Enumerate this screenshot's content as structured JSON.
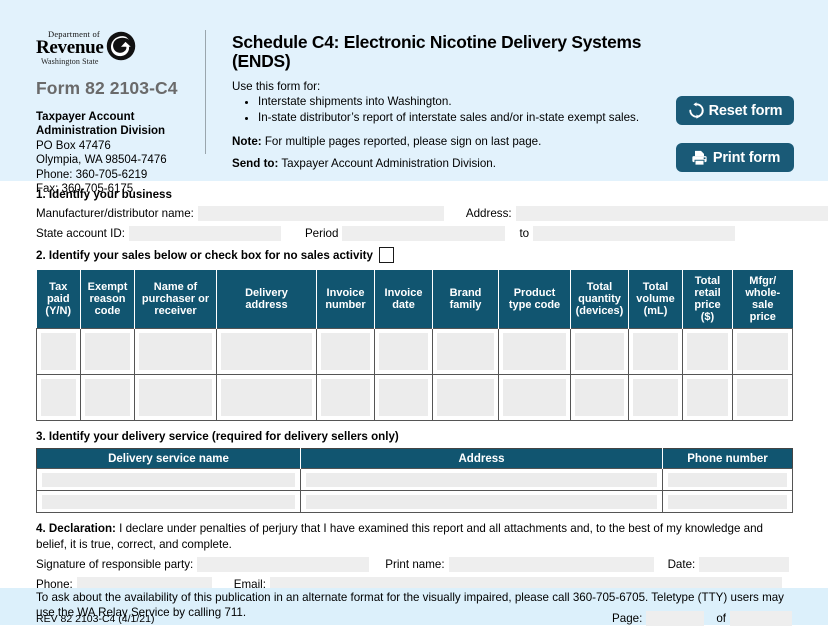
{
  "agency": {
    "dept_line": "Department of",
    "name": "Revenue",
    "state": "Washington State",
    "logo_icon": "dor-swirl-icon"
  },
  "form": {
    "number": "Form 82 2103-C4",
    "division_line1": "Taxpayer Account",
    "division_line2": "Administration Division",
    "po_box": "PO Box 47476",
    "city_state_zip": "Olympia, WA 98504-7476",
    "phone": "Phone: 360-705-6219",
    "fax": "Fax: 360-705-6175"
  },
  "header": {
    "title": "Schedule C4: Electronic Nicotine Delivery Systems (ENDS)",
    "use_for_label": "Use this form for:",
    "bullets": [
      "Interstate shipments into Washington.",
      "In-state distributor’s report of interstate sales and/or in-state exempt sales."
    ],
    "note_label": "Note:",
    "note_text": " For multiple pages reported, please sign on last page.",
    "sendto_label": "Send to:",
    "sendto_text": " Taxpayer Account Administration Division."
  },
  "buttons": {
    "reset_label": "Reset form",
    "reset_icon": "reset-circular-arrow-icon",
    "print_label": "Print form",
    "print_icon": "printer-icon",
    "color": "#1a5a77"
  },
  "section1": {
    "heading": "1. Identify your business",
    "manufacturer_label": "Manufacturer/distributor name:",
    "manufacturer_value": "",
    "address_label": "Address:",
    "address_value": "",
    "state_account_label": "State account ID:",
    "state_account_value": "",
    "period_label": "Period",
    "period_from_value": "",
    "period_to_label": "to",
    "period_to_value": ""
  },
  "section2": {
    "heading": "2. Identify your sales below or check box for no sales activity",
    "no_sales_checked": false,
    "columns": [
      "Tax paid (Y/N)",
      "Exempt reason code",
      "Name of purchaser or receiver",
      "Delivery address",
      "Invoice number",
      "Invoice date",
      "Brand family",
      "Product type code",
      "Total quantity (devices)",
      "Total volume (mL)",
      "Total retail price ($)",
      "Mfgr/ whole- sale price"
    ],
    "columns_lines": [
      [
        "Tax",
        "paid",
        "(Y/N)"
      ],
      [
        "Exempt",
        "reason",
        "code"
      ],
      [
        "Name of",
        "purchaser or",
        "receiver"
      ],
      [
        "Delivery",
        "address"
      ],
      [
        "Invoice",
        "number"
      ],
      [
        "Invoice",
        "date"
      ],
      [
        "Brand",
        "family"
      ],
      [
        "Product",
        "type code"
      ],
      [
        "Total",
        "quantity",
        "(devices)"
      ],
      [
        "Total",
        "volume",
        "(mL)"
      ],
      [
        "Total",
        "retail",
        "price",
        "($)"
      ],
      [
        "Mfgr/",
        "whole-",
        "sale",
        "price"
      ]
    ],
    "rows": [
      [
        "",
        "",
        "",
        "",
        "",
        "",
        "",
        "",
        "",
        "",
        "",
        ""
      ],
      [
        "",
        "",
        "",
        "",
        "",
        "",
        "",
        "",
        "",
        "",
        "",
        ""
      ]
    ]
  },
  "section3": {
    "heading": "3. Identify your delivery service (required for delivery sellers only)",
    "columns": [
      "Delivery service name",
      "Address",
      "Phone number"
    ],
    "rows": [
      [
        "",
        "",
        ""
      ],
      [
        "",
        "",
        ""
      ]
    ]
  },
  "section4": {
    "label": "4. Declaration:",
    "text": " I declare under penalties of perjury that I have examined this report and all attachments and, to the best of my knowledge and belief, it is true, correct, and complete.",
    "signature_label": "Signature of responsible party:",
    "signature_value": "",
    "print_name_label": "Print name:",
    "print_name_value": "",
    "date_label": "Date:",
    "date_value": "",
    "phone_label": "Phone:",
    "phone_value": "",
    "email_label": "Email:",
    "email_value": ""
  },
  "footer": {
    "accessibility_note": "To ask about the availability of this publication in an alternate format for the visually impaired, please call 360-705-6705. Teletype (TTY) users may use the WA Relay Service by calling 711.",
    "revision": "REV 82 2103-C4  (4/1/21)",
    "page_label": "Page:",
    "page_value": "",
    "of_label": "of",
    "of_value": ""
  }
}
